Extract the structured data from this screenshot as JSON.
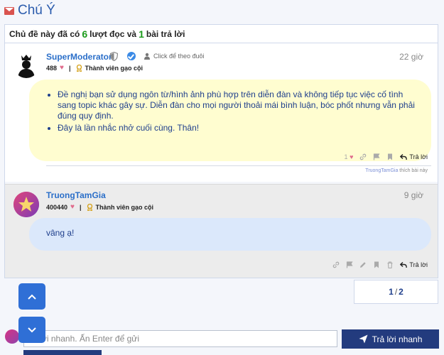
{
  "header": {
    "title": "Chú Ý"
  },
  "topic_bar": {
    "prefix": "Chủ đề này đã có",
    "views": "6",
    "mid": "lượt đọc và",
    "replies": "1",
    "suffix": "bài trả lời"
  },
  "posts": [
    {
      "username": "SuperModerator",
      "follow": "Click để theo đuôi",
      "time": "22 giờ",
      "points": "488",
      "rank": "Thành viên gạo cội",
      "content": [
        "Đề nghị bạn sử dụng ngôn từ/hình ảnh phù hợp trên diễn đàn và không tiếp tục việc cố tình sang topic khác gây sự. Diễn đàn cho mọi người thoải mái bình luận, bóc phốt nhưng vẫn phải đúng quy định.",
        "Đây là lần nhắc nhở cuối cùng. Thân!"
      ],
      "likes": "1",
      "reply": "Trả lời",
      "liked_by": "TruongTamGia",
      "liked_suffix": "thích bài này"
    },
    {
      "username": "TruongTamGia",
      "time": "9 giờ",
      "points": "400440",
      "rank": "Thành viên gạo cội",
      "content": "vâng ạ!",
      "reply": "Trả lời"
    }
  ],
  "pagination": {
    "current": "1",
    "total": "2"
  },
  "quick_reply": {
    "placeholder": "Trả lời nhanh. Ấn Enter để gửi",
    "visible_text": "ời nhanh. Ấn Enter để gửi",
    "button": "Trả lời nhanh"
  },
  "colors": {
    "accent": "#2f6fd6",
    "username": "#2b6fc9",
    "dark_button": "#233b7e",
    "notice_bg": "#fffdd0",
    "reply_bg": "#dbe8fb"
  }
}
